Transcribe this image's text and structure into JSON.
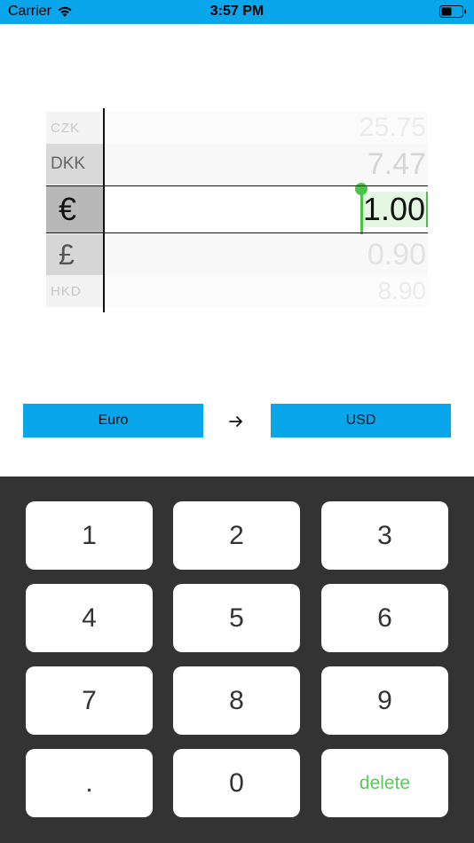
{
  "status_bar": {
    "carrier": "Carrier",
    "time": "3:57 PM",
    "wifi_icon": "wifi-icon",
    "battery_icon": "battery-icon"
  },
  "picker": {
    "rows": [
      {
        "code": "CZK",
        "rate": "25.75"
      },
      {
        "code": "DKK",
        "rate": "7.47"
      },
      {
        "code": "€",
        "rate": "1.00"
      },
      {
        "code": "£",
        "rate": "0.90"
      },
      {
        "code": "HKD",
        "rate": "8.90"
      }
    ]
  },
  "selector": {
    "from": "Euro",
    "arrow_icon": "arrow-right-icon",
    "to": "USD"
  },
  "keypad": {
    "keys": [
      "1",
      "2",
      "3",
      "4",
      "5",
      "6",
      "7",
      "8",
      "9",
      ".",
      "0",
      "delete"
    ]
  },
  "colors": {
    "accent": "#0aa6ec",
    "keypad_background": "#333333",
    "cursor_green": "#4cc24c"
  }
}
